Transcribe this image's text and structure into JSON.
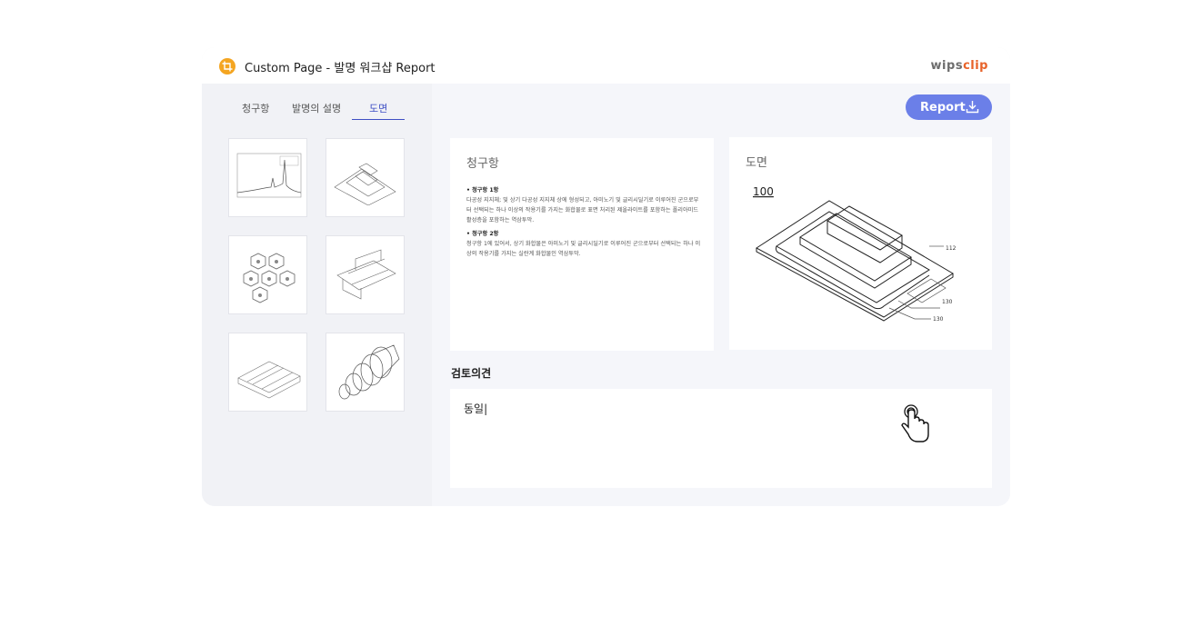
{
  "header": {
    "title": "Custom Page - 발명 워크샵 Report",
    "brand_part1": "wips",
    "brand_part2": "clip"
  },
  "sidebar": {
    "tabs": [
      {
        "label": "청구항"
      },
      {
        "label": "발명의 설명"
      },
      {
        "label": "도면"
      }
    ],
    "active_tab": "도면"
  },
  "toolbar": {
    "report_label": "Report"
  },
  "claims_card": {
    "title": "청구항",
    "claims": [
      {
        "head": "청구항 1항",
        "body": "다공성 지지체; 및 상기 다공성 지지체 상에 형성되고, 아미노기 및 글리시딜기로 이루어진 군으로부터 선택되는 하나 이상의 작용기를 가지는 화합물로 표면 처리된 제올라이트를 포함하는 폴리아미드 활성층을 포함하는 역삼투막."
      },
      {
        "head": "청구항 2항",
        "body": "청구항 1에 있어서, 상기 화합물은 아미노기 및 글리시딜기로 이루어진 군으로부터 선택되는 하나 이상의 작용기를 가지는 실란계 화합물인 역삼투막."
      }
    ]
  },
  "drawing_card": {
    "title": "도면",
    "figure_labels": {
      "main": "100",
      "a": "112",
      "b": "130",
      "c": "130"
    }
  },
  "review": {
    "label": "검토의견",
    "value": "동일|"
  },
  "colors": {
    "accent": "#3e4fc4",
    "button": "#6b7fe8",
    "logo": "#f4a521",
    "brand_orange": "#e8632a"
  }
}
